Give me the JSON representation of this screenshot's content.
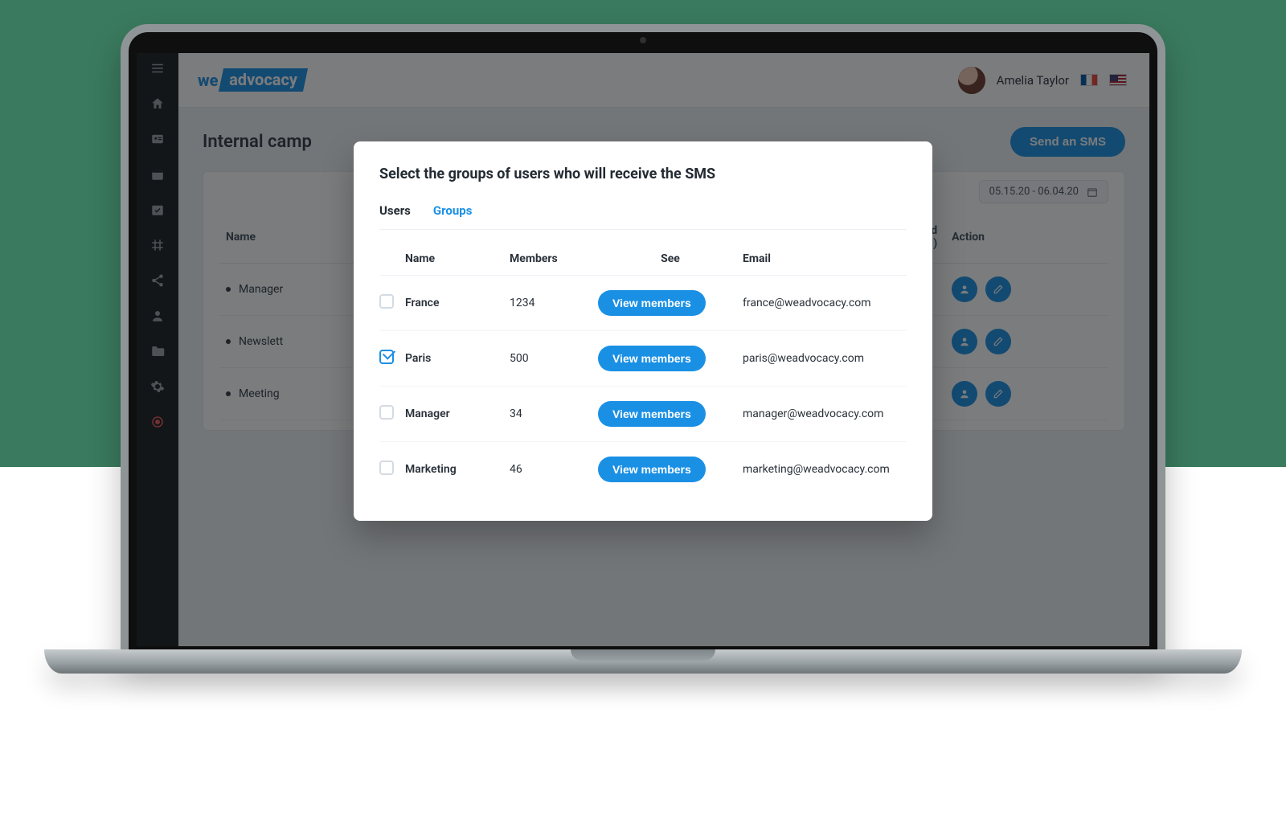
{
  "header": {
    "logo_left": "we",
    "logo_right": "advocacy",
    "user_name": "Amelia Taylor"
  },
  "sidebar": {
    "items": [
      {
        "name": "menu-icon"
      },
      {
        "name": "home-icon"
      },
      {
        "name": "id-card-icon"
      },
      {
        "name": "calendar-icon"
      },
      {
        "name": "calendar-check-icon"
      },
      {
        "name": "grid-icon"
      },
      {
        "name": "share-icon"
      },
      {
        "name": "user-icon"
      },
      {
        "name": "folder-icon"
      },
      {
        "name": "gear-icon"
      },
      {
        "name": "record-icon"
      }
    ]
  },
  "page": {
    "title_partial": "Internal camp",
    "send_button": "Send an SMS",
    "date_range": "05.15.20 - 06.04.20",
    "columns": {
      "name": "Name",
      "received_partial": "eived\n)",
      "action": "Action"
    },
    "rows": [
      {
        "name_partial": "Manager"
      },
      {
        "name_partial": "Newslett"
      },
      {
        "name_partial": "Meeting"
      }
    ]
  },
  "modal": {
    "title": "Select the groups of users who will receive the SMS",
    "tabs": {
      "users": "Users",
      "groups": "Groups"
    },
    "columns": {
      "name": "Name",
      "members": "Members",
      "see": "See",
      "email": "Email"
    },
    "view_members_label": "View members",
    "rows": [
      {
        "checked": false,
        "name": "France",
        "members": "1234",
        "email": "france@weadvocacy.com"
      },
      {
        "checked": true,
        "name": "Paris",
        "members": "500",
        "email": "paris@weadvocacy.com"
      },
      {
        "checked": false,
        "name": "Manager",
        "members": "34",
        "email": "manager@weadvocacy.com"
      },
      {
        "checked": false,
        "name": "Marketing",
        "members": "46",
        "email": "marketing@weadvocacy.com"
      }
    ]
  },
  "colors": {
    "accent": "#1a90e5"
  }
}
